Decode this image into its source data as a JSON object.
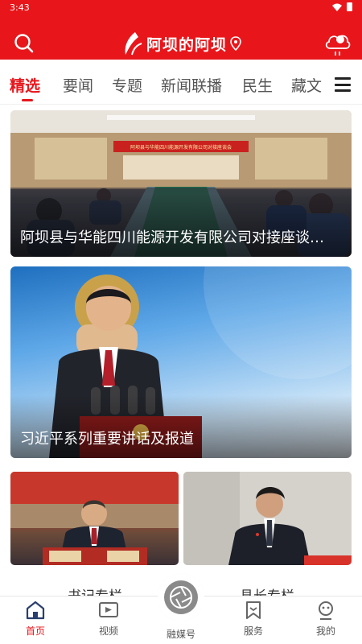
{
  "status": {
    "time": "3:43"
  },
  "header": {
    "app_title": "阿坝的阿坝"
  },
  "tabs": [
    {
      "label": "精选",
      "active": true
    },
    {
      "label": "要闻"
    },
    {
      "label": "专题"
    },
    {
      "label": "新闻联播"
    },
    {
      "label": "民生"
    },
    {
      "label": "藏文"
    }
  ],
  "cards": [
    {
      "caption": "阿坝县与华能四川能源开发有限公司对接座谈…",
      "banner_text": "阿坝县与华能四川能源开发有限公司对接座谈会"
    },
    {
      "caption": "习近平系列重要讲话及报道"
    }
  ],
  "columns": {
    "left_label": "书记专栏",
    "right_label": "县长专栏"
  },
  "bottom_nav": [
    {
      "label": "首页",
      "icon": "home-icon",
      "active": true
    },
    {
      "label": "视频",
      "icon": "video-icon"
    },
    {
      "label": "融媒号",
      "icon": "camera-aperture-icon"
    },
    {
      "label": "服务",
      "icon": "bookmark-icon"
    },
    {
      "label": "我的",
      "icon": "profile-icon"
    }
  ],
  "colors": {
    "brand_red": "#e8161b",
    "text_dark": "#333333"
  }
}
